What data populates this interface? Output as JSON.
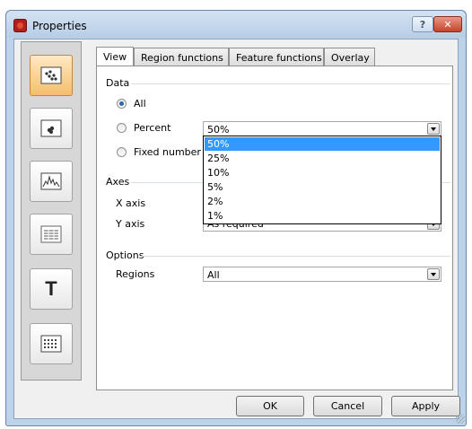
{
  "window": {
    "title": "Properties",
    "help_symbol": "?",
    "close_symbol": "✕"
  },
  "sidebar": {
    "buttons": [
      {
        "icon": "scatter-plot-icon",
        "active": true
      },
      {
        "icon": "dot-plot-icon",
        "active": false
      },
      {
        "icon": "histogram-icon",
        "active": false
      },
      {
        "icon": "table-icon",
        "active": false
      },
      {
        "icon": "text-icon",
        "glyph": "T",
        "active": false
      },
      {
        "icon": "grid-icon",
        "active": false
      }
    ]
  },
  "tabs": [
    "View",
    "Region functions",
    "Feature functions",
    "Overlay"
  ],
  "view": {
    "data_group": "Data",
    "radio_all": "All",
    "radio_percent": "Percent",
    "radio_fixed": "Fixed number",
    "percent_value": "50%",
    "percent_options": [
      "50%",
      "25%",
      "10%",
      "5%",
      "2%",
      "1%"
    ],
    "axes_group": "Axes",
    "x_axis_label": "X axis",
    "y_axis_label": "Y axis",
    "y_axis_value": "As required",
    "options_group": "Options",
    "regions_label": "Regions",
    "regions_value": "All"
  },
  "buttons": {
    "ok": "OK",
    "cancel": "Cancel",
    "apply": "Apply"
  }
}
